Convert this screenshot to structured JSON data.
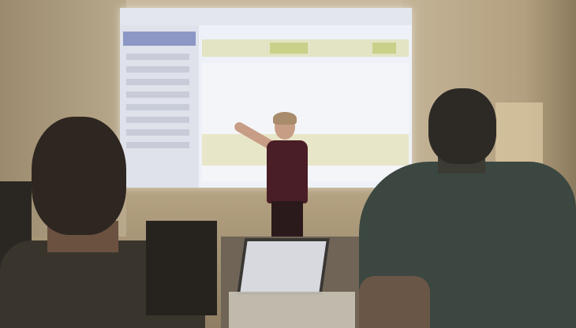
{
  "scene": {
    "description_colors": {
      "wall": "#b9a98c",
      "screen": "#eef1f7",
      "presenter_top": "#4a1e26",
      "audience_shirt_right": "#3b4740",
      "audience_shirt_left": "#3a352c"
    }
  }
}
